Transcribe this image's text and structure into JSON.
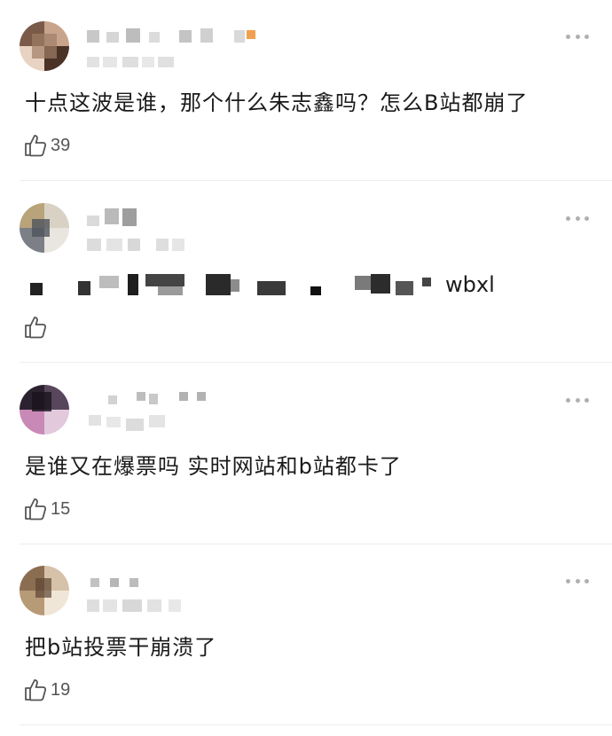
{
  "comments": [
    {
      "text": "十点这波是谁，那个什么朱志鑫吗？怎么B站都崩了",
      "likes": "39",
      "avatar_colors": [
        "#7a5a48",
        "#c9a48c",
        "#e8d2c2",
        "#4a3226"
      ]
    },
    {
      "text_tail": "wbxl",
      "likes": "",
      "avatar_colors": [
        "#b8a37a",
        "#d9d2c4",
        "#7c7f86",
        "#e9e6df"
      ]
    },
    {
      "text": "是谁又在爆票吗 实时网站和b站都卡了",
      "likes": "15",
      "avatar_colors": [
        "#2b2230",
        "#c989b6",
        "#e2c9dc",
        "#57465c"
      ]
    },
    {
      "text": "把b站投票干崩溃了",
      "likes": "19",
      "avatar_colors": [
        "#8b6e52",
        "#d6c2a8",
        "#b79a76",
        "#f0e6d8"
      ]
    }
  ],
  "icons": {
    "more": "more-dots-icon",
    "like": "thumbs-up-icon"
  },
  "colors": {
    "text": "#1a1a1a",
    "secondary": "#555555",
    "icon": "#b0b0b0",
    "divider": "#ececec"
  }
}
